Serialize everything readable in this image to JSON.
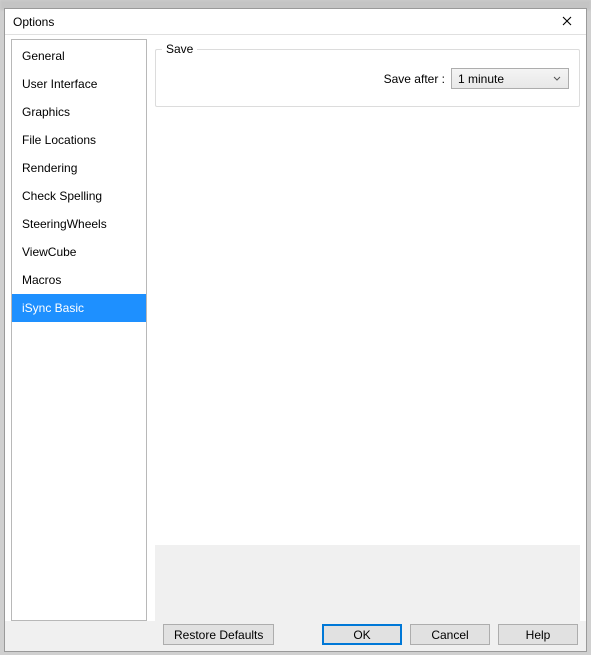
{
  "dialog": {
    "title": "Options"
  },
  "sidebar": {
    "items": [
      {
        "label": "General"
      },
      {
        "label": "User Interface"
      },
      {
        "label": "Graphics"
      },
      {
        "label": "File Locations"
      },
      {
        "label": "Rendering"
      },
      {
        "label": "Check Spelling"
      },
      {
        "label": "SteeringWheels"
      },
      {
        "label": "ViewCube"
      },
      {
        "label": "Macros"
      },
      {
        "label": "iSync Basic"
      }
    ],
    "selected_index": 9
  },
  "content": {
    "group_title": "Save",
    "save_after_label": "Save after :",
    "save_after_value": "1 minute"
  },
  "footer": {
    "restore": "Restore Defaults",
    "ok": "OK",
    "cancel": "Cancel",
    "help": "Help"
  }
}
